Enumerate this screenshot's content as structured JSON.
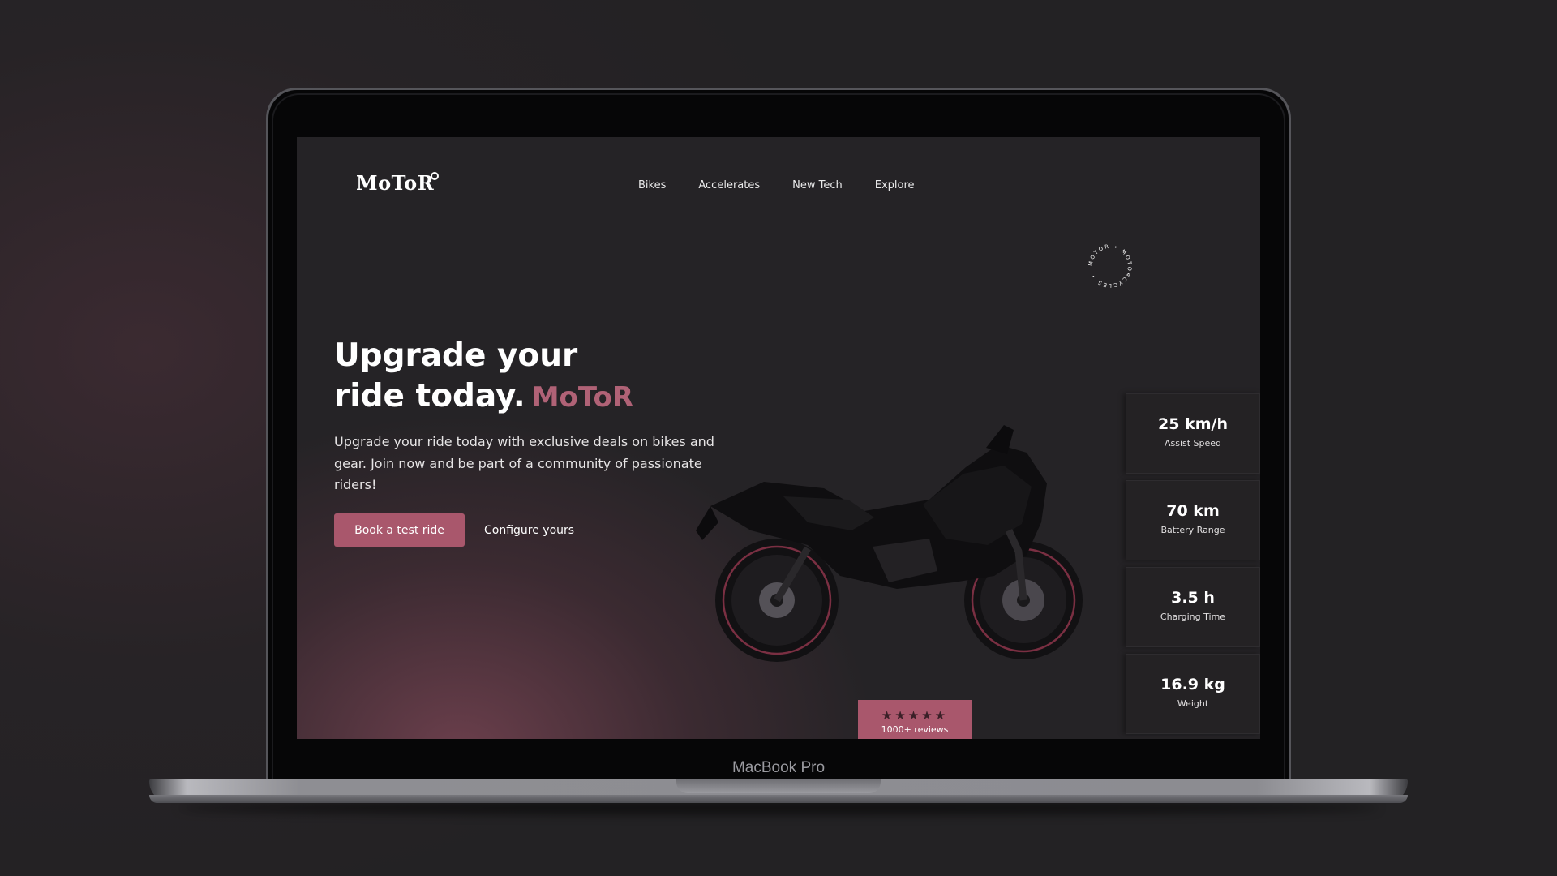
{
  "mockup": {
    "device_label": "MacBook Pro"
  },
  "header": {
    "logo": "MoToR",
    "nav": [
      "Bikes",
      "Accelerates",
      "New Tech",
      "Explore"
    ]
  },
  "circle_badge": {
    "text": "MOTOR • MOTORCYCLES • "
  },
  "hero": {
    "title_line1": "Upgrade your",
    "title_line2": "ride today.",
    "title_brand": "MoToR",
    "description": "Upgrade your ride today with exclusive deals on bikes and gear. Join now and be part of a community of passionate riders!",
    "primary_button": "Book a test ride",
    "secondary_button": "Configure yours"
  },
  "reviews": {
    "rating": 4.5,
    "max": 5,
    "stars": "★★★★★",
    "label": "1000+ reviews"
  },
  "specs": [
    {
      "value": "25 km/h",
      "label": "Assist Speed"
    },
    {
      "value": "70 km",
      "label": "Battery Range"
    },
    {
      "value": "3.5 h",
      "label": "Charging Time"
    },
    {
      "value": "16.9 kg",
      "label": "Weight"
    }
  ],
  "colors": {
    "accent": "#a9576c",
    "accent_text": "#b06276",
    "background": "#252326"
  }
}
